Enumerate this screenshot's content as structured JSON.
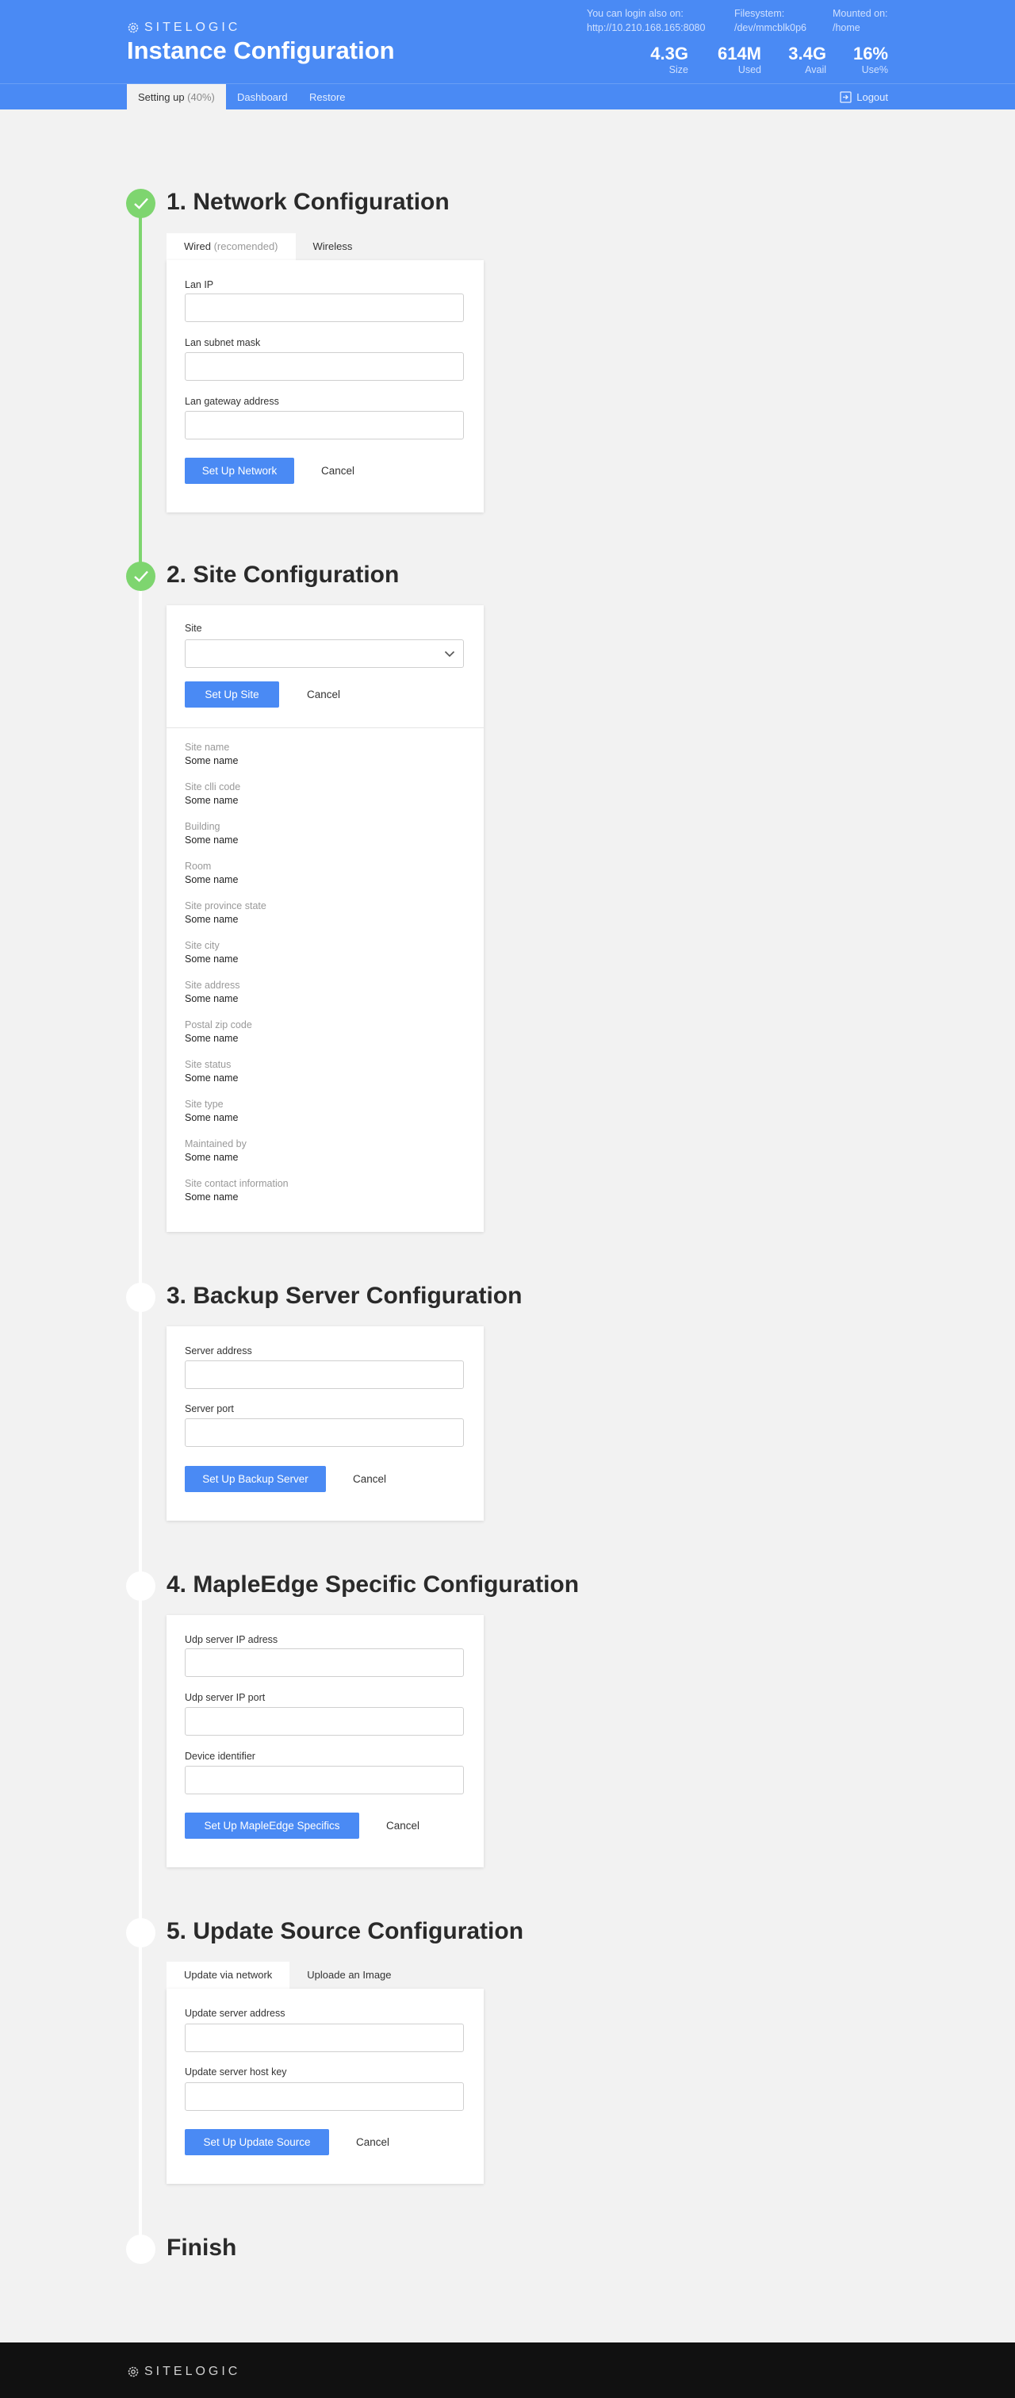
{
  "header": {
    "brand": "SITELOGIC",
    "title": "Instance Configuration",
    "login_label": "You can login also on:",
    "login_value": "http://10.210.168.165:8080",
    "fs_label": "Filesystem:",
    "fs_value": "/dev/mmcblk0p6",
    "mount_label": "Mounted on:",
    "mount_value": "/home",
    "stats": [
      {
        "value": "4.3G",
        "label": "Size"
      },
      {
        "value": "614M",
        "label": "Used"
      },
      {
        "value": "3.4G",
        "label": "Avail"
      },
      {
        "value": "16%",
        "label": "Use%"
      }
    ]
  },
  "nav": {
    "setup_label": "Setting up",
    "setup_pct": "(40%)",
    "dashboard": "Dashboard",
    "restore": "Restore",
    "logout": "Logout"
  },
  "steps": {
    "network": {
      "title": "1. Network Configuration",
      "tab_wired": "Wired",
      "tab_wired_note": "(recomended)",
      "tab_wireless": "Wireless",
      "lan_ip": "Lan IP",
      "lan_subnet": "Lan subnet mask",
      "lan_gateway": "Lan gateway address",
      "submit": "Set Up Network",
      "cancel": "Cancel"
    },
    "site": {
      "title": "2. Site Configuration",
      "site_label": "Site",
      "submit": "Set Up Site",
      "cancel": "Cancel",
      "props": [
        {
          "label": "Site name",
          "value": "Some name"
        },
        {
          "label": "Site clli code",
          "value": "Some name"
        },
        {
          "label": "Building",
          "value": "Some name"
        },
        {
          "label": "Room",
          "value": "Some name"
        },
        {
          "label": "Site province state",
          "value": "Some name"
        },
        {
          "label": "Site city",
          "value": "Some name"
        },
        {
          "label": "Site address",
          "value": "Some name"
        },
        {
          "label": "Postal zip code",
          "value": "Some name"
        },
        {
          "label": "Site status",
          "value": "Some name"
        },
        {
          "label": "Site type",
          "value": "Some name"
        },
        {
          "label": "Maintained by",
          "value": "Some name"
        },
        {
          "label": "Site contact information",
          "value": "Some name"
        }
      ]
    },
    "backup": {
      "title": "3. Backup Server Configuration",
      "server_address": "Server address",
      "server_port": "Server port",
      "submit": "Set Up Backup Server",
      "cancel": "Cancel"
    },
    "mapleedge": {
      "title": "4. MapleEdge Specific Configuration",
      "udp_ip": "Udp server IP adress",
      "udp_port": "Udp server IP port",
      "device_id": "Device identifier",
      "submit": "Set Up MapleEdge Specifics",
      "cancel": "Cancel"
    },
    "update": {
      "title": "5. Update Source Configuration",
      "tab_network": "Update via network",
      "tab_image": "Uploade an Image",
      "server_address": "Update server address",
      "host_key": "Update server host key",
      "submit": "Set Up Update Source",
      "cancel": "Cancel"
    },
    "finish": {
      "title": "Finish"
    }
  },
  "footer": {
    "brand": "SITELOGIC"
  },
  "colors": {
    "primary": "#4a8af4",
    "done": "#7ed56f",
    "footer": "#111111"
  }
}
